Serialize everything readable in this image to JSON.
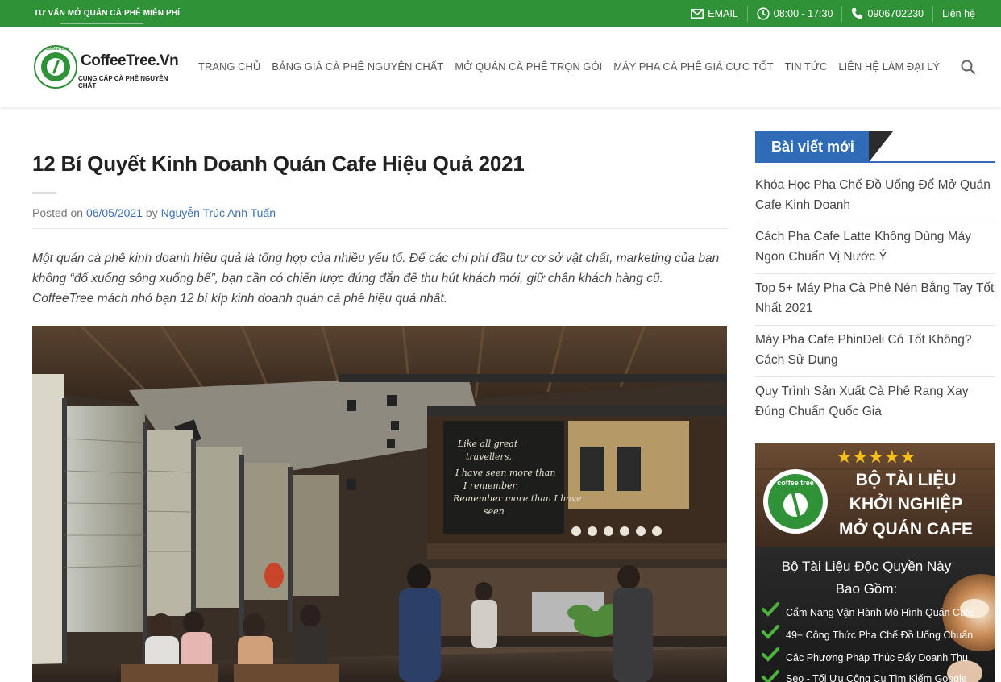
{
  "topbar": {
    "promo": "TƯ VẤN MỞ QUÁN CÀ PHÊ MIỄN PHÍ",
    "email_label": "EMAIL",
    "hours": "08:00 - 17:30",
    "phone": "0906702230",
    "contact": "Liên hệ",
    "icons": [
      "envelope-icon",
      "clock-icon",
      "phone-icon"
    ]
  },
  "header": {
    "logo_brand": "CoffeeTree.Vn",
    "logo_ring": "coffee tree",
    "logo_tagline": "CUNG CẤP CÀ PHÊ NGUYÊN CHẤT",
    "nav": [
      "TRANG CHỦ",
      "BẢNG GIÁ CÀ PHÊ NGUYÊN CHẤT",
      "MỞ QUÁN CÀ PHÊ TRỌN GÓI",
      "MÁY PHA CÀ PHÊ GIÁ CỰC TỐT",
      "TIN TỨC",
      "LIÊN HỆ LÀM ĐẠI LÝ"
    ],
    "search_icon": "search-icon"
  },
  "article": {
    "title": "12 Bí Quyết Kinh Doanh Quán Cafe Hiệu Quả 2021",
    "posted_on": "Posted on ",
    "date": "06/05/2021",
    "by": " by ",
    "author": "Nguyễn Trúc Anh Tuấn",
    "intro": "Một quán cà phê kinh doanh hiệu quả là tổng hợp của nhiều yếu tố. Để các chi phí đầu tư cơ sở vật chất, marketing của bạn không “đổ xuống sông xuống bể”, bạn cần có chiến lược đúng đắn để thu hút khách mới, giữ chân khách hàng cũ. CoffeeTree mách nhỏ bạn 12 bí kíp kinh doanh quán cà phê hiệu quả nhất.",
    "chalkboard_text": [
      "Like all great",
      "travellers,",
      "I have seen more than",
      "I remember,",
      "Remember more than I have",
      "seen"
    ]
  },
  "sidebar": {
    "widget_title": "Bài viết mới",
    "posts": [
      "Khóa Học Pha Chế Đồ Uống Để Mở Quán Cafe Kinh Doanh",
      "Cách Pha Cafe Latte Không Dùng Máy Ngon Chuẩn Vị Nước Ý",
      "Top 5+ Máy Pha Cà Phê Nén Bằng Tay Tốt Nhất 2021",
      "Máy Pha Cafe PhinDeli Có Tốt Không? Cách Sử Dụng",
      "Quy Trình Sản Xuất Cà Phê Rang Xay Đúng Chuẩn Quốc Gia"
    ],
    "banner": {
      "stars": "★★★★★",
      "title_lines": [
        "BỘ TÀI LIỆU",
        "KHỞI NGHIỆP",
        "MỞ QUÁN CAFE"
      ],
      "subtitle_lines": [
        "Bộ Tài Liệu Độc Quyền Này",
        "Bao Gồm:"
      ],
      "items": [
        "Cẩm Nang Vận Hành Mô Hình Quán Cafe",
        "49+ Công Thức Pha Chế Đồ Uống Chuẩn",
        "Các Phương Pháp Thúc Đẩy Doanh Thu",
        "Seo - Tối Ưu Công Cụ Tìm Kiếm Google"
      ],
      "logo_text": "coffee tree"
    }
  },
  "colors": {
    "topbar_green": "#2f9237",
    "widget_blue": "#2f6bb6",
    "link_blue": "#3b6fb6"
  }
}
